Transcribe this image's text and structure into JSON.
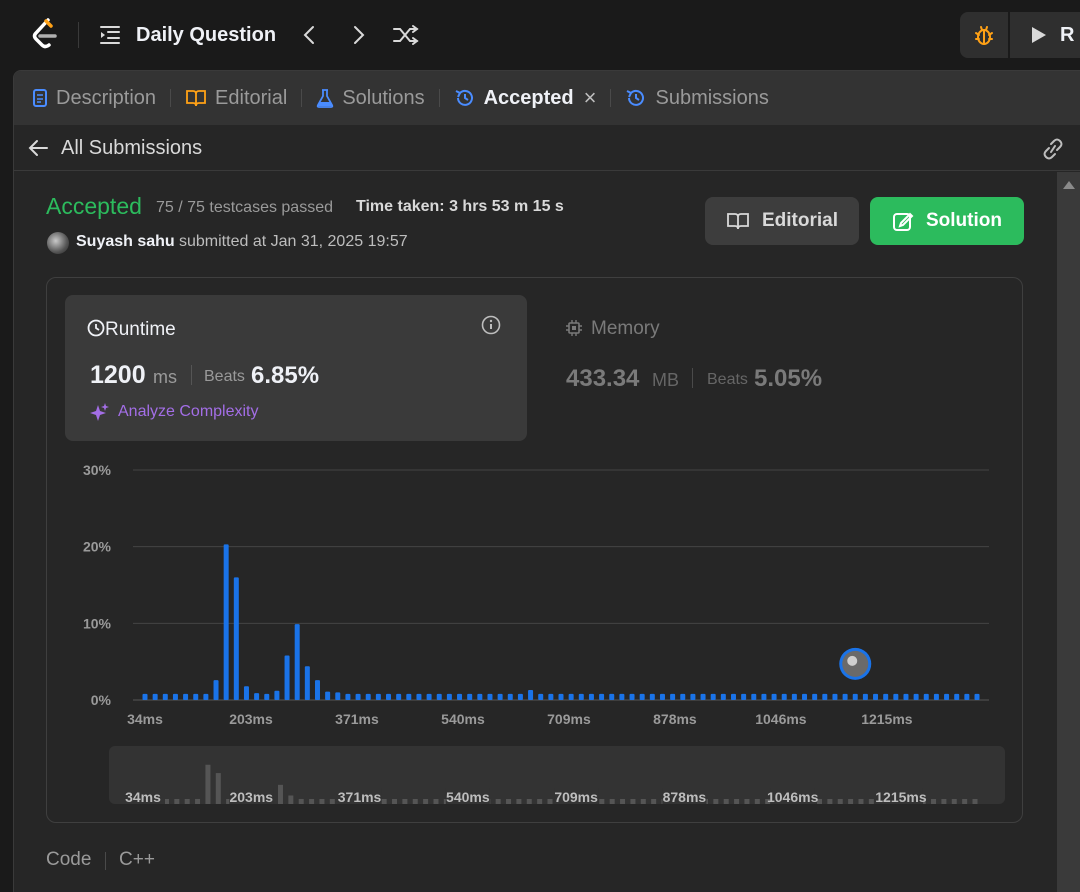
{
  "topbar": {
    "daily_question": "Daily Question",
    "run_label": "R"
  },
  "tabs": [
    {
      "label": "Description"
    },
    {
      "label": "Editorial"
    },
    {
      "label": "Solutions"
    },
    {
      "label": "Accepted"
    },
    {
      "label": "Submissions"
    }
  ],
  "subheader": {
    "all_submissions": "All Submissions"
  },
  "submission": {
    "status": "Accepted",
    "testcases": "75 / 75 testcases passed",
    "time_taken": "Time taken: 3 hrs 53 m 15 s",
    "author": "Suyash sahu",
    "submitted_at": "submitted at Jan 31, 2025 19:57"
  },
  "buttons": {
    "editorial": "Editorial",
    "solution": "Solution"
  },
  "runtime": {
    "title": "Runtime",
    "value": "1200",
    "unit": "ms",
    "beats_label": "Beats",
    "beats": "6.85%",
    "analyze": "Analyze Complexity"
  },
  "memory": {
    "title": "Memory",
    "value": "433.34",
    "unit": "MB",
    "beats_label": "Beats",
    "beats": "5.05%"
  },
  "colors": {
    "accent_green": "#2cbb5d",
    "bar_blue": "#1a73e8",
    "analyze_purple": "#a36ee6"
  },
  "chart_data": {
    "type": "bar",
    "ylim": [
      0,
      30
    ],
    "yticks": [
      "0%",
      "10%",
      "20%",
      "30%"
    ],
    "xticks": [
      "34ms",
      "203ms",
      "371ms",
      "540ms",
      "709ms",
      "878ms",
      "1046ms",
      "1215ms"
    ],
    "values": [
      0.8,
      0.8,
      0.8,
      0.8,
      0.8,
      0.8,
      0.8,
      2.6,
      20.3,
      16,
      1.8,
      0.9,
      0.8,
      1.2,
      5.8,
      9.9,
      4.4,
      2.6,
      1.1,
      1,
      0.8,
      0.8,
      0.8,
      0.8,
      0.8,
      0.8,
      0.8,
      0.8,
      0.8,
      0.8,
      0.8,
      0.8,
      0.8,
      0.8,
      0.8,
      0.8,
      0.8,
      0.8,
      1.3,
      0.8,
      0.8,
      0.8,
      0.8,
      0.8,
      0.8,
      0.8,
      0.8,
      0.8,
      0.8,
      0.8,
      0.8,
      0.8,
      0.8,
      0.8,
      0.8,
      0.8,
      0.8,
      0.8,
      0.8,
      0.8,
      0.8,
      0.8,
      0.8,
      0.8,
      0.8,
      0.8,
      0.8,
      0.8,
      0.8,
      0.8,
      0.8,
      0.8,
      0.8,
      0.8,
      0.8,
      0.8,
      0.8,
      0.8,
      0.8,
      0.8,
      0.8,
      0.8,
      0.8
    ],
    "marker_index": 70
  },
  "code": {
    "label": "Code",
    "language": "C++"
  }
}
